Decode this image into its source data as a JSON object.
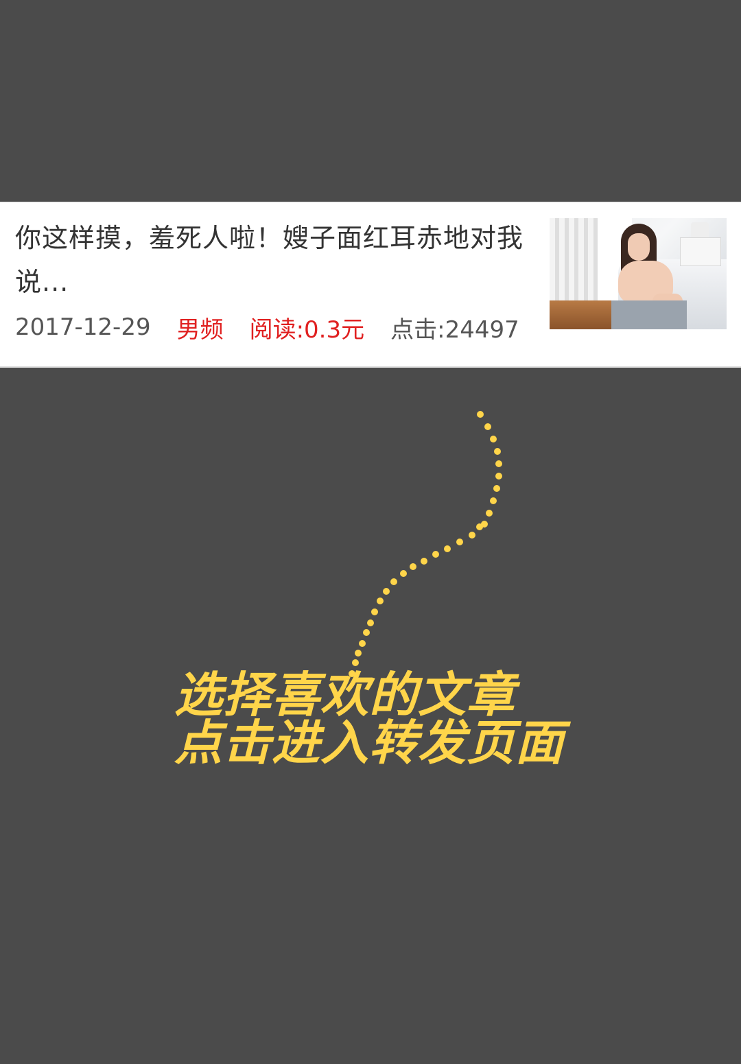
{
  "article": {
    "title": "你这样摸，羞死人啦！嫂子面红耳赤地对我说...",
    "date": "2017-12-29",
    "category": "男频",
    "read_price": "阅读:0.3元",
    "clicks": "点击:24497"
  },
  "instruction": {
    "line1": "选择喜欢的文章",
    "line2": "点击进入转发页面"
  },
  "colors": {
    "overlay": "#4b4b4b",
    "accent_red": "#e02020",
    "highlight_yellow": "#ffd54a"
  }
}
